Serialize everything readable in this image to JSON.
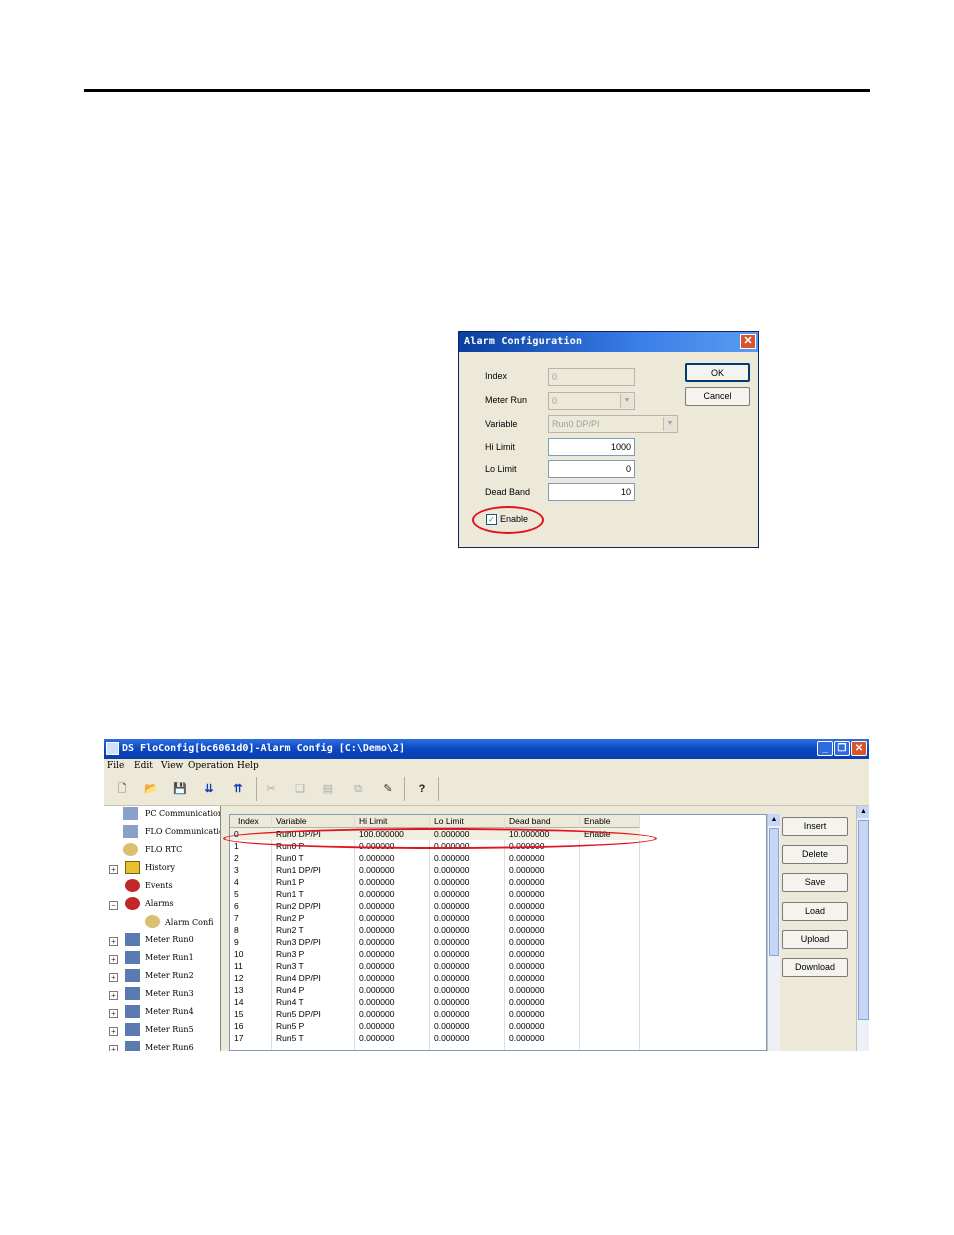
{
  "dialog": {
    "title": "Alarm Configuration",
    "close_glyph": "✕",
    "index_label": "Index",
    "index_value": "0",
    "meter_run_label": "Meter Run",
    "meter_run_value": "0",
    "variable_label": "Variable",
    "variable_value": "Run0 DP/PI",
    "hi_limit_label": "Hi Limit",
    "hi_limit_value": "1000",
    "lo_limit_label": "Lo Limit",
    "lo_limit_value": "0",
    "dead_band_label": "Dead Band",
    "dead_band_value": "10",
    "enable_label": "Enable",
    "enable_checked": true,
    "ok_label": "OK",
    "cancel_label": "Cancel",
    "highlight_color": "#e0141e"
  },
  "app": {
    "title": "DS FloConfig[bc6061d0]-Alarm Config [C:\\Demo\\2]",
    "menu": [
      "File",
      "Edit",
      "View",
      "Operation",
      "Help"
    ],
    "toolbar_icons": [
      "new-icon",
      "open-icon",
      "save-icon",
      "download-icon",
      "upload-icon",
      "cut-icon",
      "copy-icon",
      "paste-icon",
      "multi-copy-icon",
      "erase-icon",
      "help-icon"
    ],
    "tree": [
      {
        "label": "PC Communication",
        "icon": "pc-network-icon"
      },
      {
        "label": "FLO Communicatio",
        "icon": "pc-network-icon"
      },
      {
        "label": "FLO RTC",
        "icon": "gear-icon"
      },
      {
        "label": "History",
        "icon": "folder-clock-icon"
      },
      {
        "label": "Events",
        "icon": "events-icon"
      },
      {
        "label": "Alarms",
        "icon": "alarm-icon"
      },
      {
        "label": "Alarm Confi",
        "icon": "gear-icon"
      },
      {
        "label": "Meter Run0",
        "icon": "meter-icon"
      },
      {
        "label": "Meter Run1",
        "icon": "meter-icon"
      },
      {
        "label": "Meter Run2",
        "icon": "meter-icon"
      },
      {
        "label": "Meter Run3",
        "icon": "meter-icon"
      },
      {
        "label": "Meter Run4",
        "icon": "meter-icon"
      },
      {
        "label": "Meter Run5",
        "icon": "meter-icon"
      },
      {
        "label": "Meter Run6",
        "icon": "meter-icon"
      }
    ],
    "columns": [
      "Index",
      "Variable",
      "Hi Limit",
      "Lo Limit",
      "Dead band",
      "Enable"
    ],
    "rows": [
      [
        "0",
        "Run0 DP/PI",
        "100.000000",
        "0.000000",
        "10.000000",
        "Enable"
      ],
      [
        "1",
        "Run0 P",
        "0.000000",
        "0.000000",
        "0.000000",
        ""
      ],
      [
        "2",
        "Run0 T",
        "0.000000",
        "0.000000",
        "0.000000",
        ""
      ],
      [
        "3",
        "Run1 DP/PI",
        "0.000000",
        "0.000000",
        "0.000000",
        ""
      ],
      [
        "4",
        "Run1 P",
        "0.000000",
        "0.000000",
        "0.000000",
        ""
      ],
      [
        "5",
        "Run1 T",
        "0.000000",
        "0.000000",
        "0.000000",
        ""
      ],
      [
        "6",
        "Run2 DP/PI",
        "0.000000",
        "0.000000",
        "0.000000",
        ""
      ],
      [
        "7",
        "Run2 P",
        "0.000000",
        "0.000000",
        "0.000000",
        ""
      ],
      [
        "8",
        "Run2 T",
        "0.000000",
        "0.000000",
        "0.000000",
        ""
      ],
      [
        "9",
        "Run3 DP/PI",
        "0.000000",
        "0.000000",
        "0.000000",
        ""
      ],
      [
        "10",
        "Run3 P",
        "0.000000",
        "0.000000",
        "0.000000",
        ""
      ],
      [
        "11",
        "Run3 T",
        "0.000000",
        "0.000000",
        "0.000000",
        ""
      ],
      [
        "12",
        "Run4 DP/PI",
        "0.000000",
        "0.000000",
        "0.000000",
        ""
      ],
      [
        "13",
        "Run4 P",
        "0.000000",
        "0.000000",
        "0.000000",
        ""
      ],
      [
        "14",
        "Run4 T",
        "0.000000",
        "0.000000",
        "0.000000",
        ""
      ],
      [
        "15",
        "Run5 DP/PI",
        "0.000000",
        "0.000000",
        "0.000000",
        ""
      ],
      [
        "16",
        "Run5 P",
        "0.000000",
        "0.000000",
        "0.000000",
        ""
      ],
      [
        "17",
        "Run5 T",
        "0.000000",
        "0.000000",
        "0.000000",
        ""
      ]
    ],
    "buttons": [
      "Insert",
      "Delete",
      "Save",
      "Load",
      "Upload",
      "Download"
    ]
  }
}
